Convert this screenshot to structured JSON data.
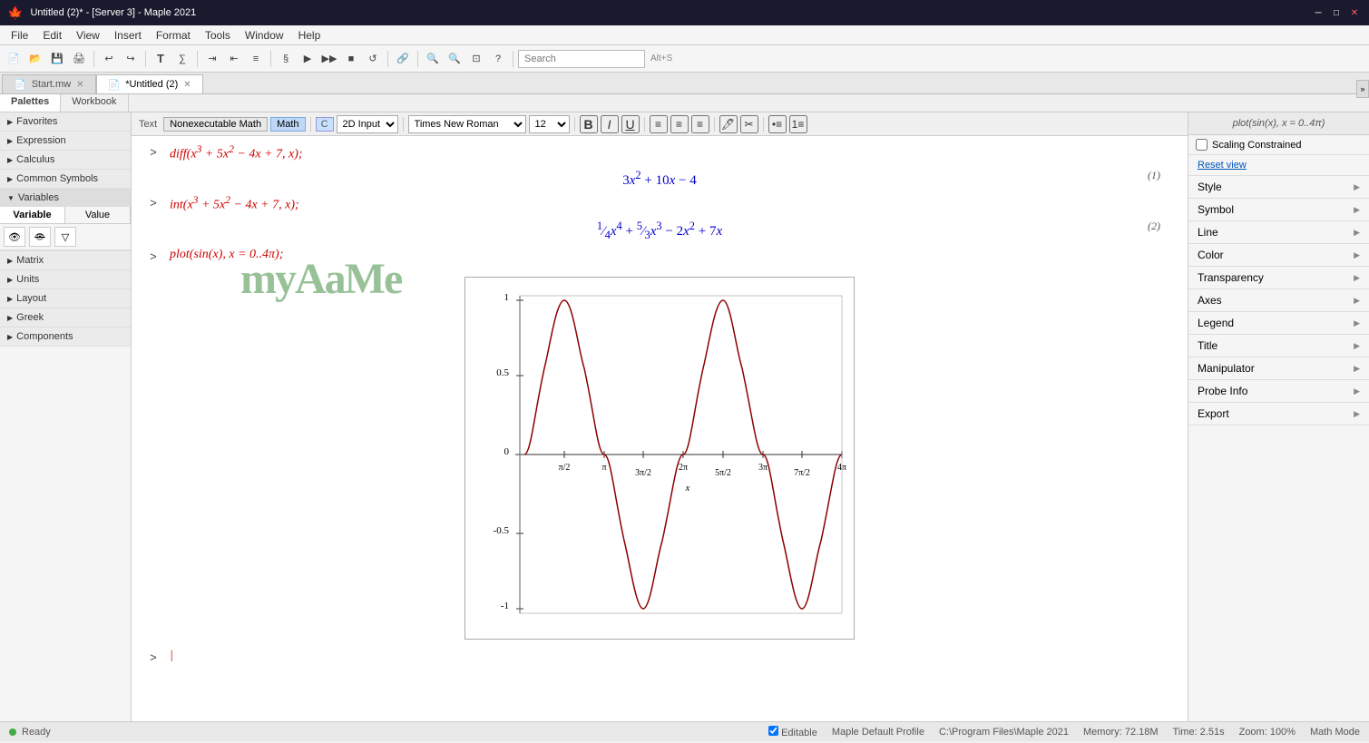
{
  "titlebar": {
    "title": "Untitled (2)* - [Server 3] - Maple 2021",
    "icon": "maple-icon",
    "controls": [
      "minimize",
      "maximize",
      "close"
    ]
  },
  "menubar": {
    "items": [
      "File",
      "Edit",
      "View",
      "Insert",
      "Format",
      "Tools",
      "Window",
      "Help"
    ]
  },
  "toolbar": {
    "search_placeholder": "Search",
    "search_shortcut": "Alt+S"
  },
  "tabs": [
    {
      "label": "Start.mw",
      "active": false
    },
    {
      "label": "*Untitled (2)",
      "active": true
    }
  ],
  "palettes_workbook": {
    "tabs": [
      "Palettes",
      "Workbook"
    ],
    "active": "Palettes"
  },
  "sidebar": {
    "sections": [
      {
        "label": "Favorites",
        "expanded": false
      },
      {
        "label": "Expression",
        "expanded": false
      },
      {
        "label": "Calculus",
        "expanded": false
      },
      {
        "label": "Common Symbols",
        "expanded": false
      },
      {
        "label": "Variables",
        "expanded": true
      }
    ],
    "variables": {
      "tabs": [
        "Variable",
        "Value"
      ],
      "active_tab": "Variable",
      "tools": [
        "eye-icon",
        "eye-slash-icon",
        "filter-icon"
      ]
    },
    "lower_sections": [
      {
        "label": "Matrix"
      },
      {
        "label": "Units"
      },
      {
        "label": "Layout"
      },
      {
        "label": "Greek"
      },
      {
        "label": "Components"
      }
    ]
  },
  "format_bar": {
    "style_label": "Text",
    "mode_buttons": [
      "Nonexecutable Math",
      "Math"
    ],
    "active_mode": "Math",
    "c_label": "C",
    "input_mode": "2D Input",
    "font_family": "Times New Roman",
    "font_size": "12",
    "bold": "B",
    "italic": "I",
    "underline": "U"
  },
  "worksheet": {
    "lines": [
      {
        "type": "input",
        "prompt": ">",
        "content": "diff(x³ + 5x² − 4x + 7, x);"
      },
      {
        "type": "output",
        "content": "3x² + 10x − 4",
        "number": "(1)"
      },
      {
        "type": "input",
        "prompt": ">",
        "content": "int(x³ + 5x² − 4x + 7, x);"
      },
      {
        "type": "output",
        "content": "¼x⁴ + 5/3x³ − 2x² + 7x",
        "number": "(2)"
      },
      {
        "type": "input",
        "prompt": ">",
        "content": "plot(sin(x), x = 0..4π);"
      }
    ],
    "plot": {
      "title": "plot(sin(x), x = 0..4π)",
      "x_min": 0,
      "x_max": "4π",
      "y_min": -1,
      "y_max": 1,
      "x_ticks": [
        "π/2",
        "π",
        "3π/2",
        "2π",
        "5π/2",
        "3π",
        "7π/2",
        "4π"
      ],
      "y_ticks": [
        "-1",
        "-0.5",
        "0",
        "0.5",
        "1"
      ],
      "curve_color": "#8b0000"
    }
  },
  "right_panel": {
    "plot_label": "plot(sin(x), x = 0..4π)",
    "reset_view": "Reset view",
    "scaling_constrained_label": "Scaling Constrained",
    "sections": [
      {
        "label": "Style"
      },
      {
        "label": "Symbol"
      },
      {
        "label": "Line"
      },
      {
        "label": "Color"
      },
      {
        "label": "Transparency"
      },
      {
        "label": "Axes"
      },
      {
        "label": "Legend"
      },
      {
        "label": "Title"
      },
      {
        "label": "Manipulator"
      },
      {
        "label": "Probe Info"
      },
      {
        "label": "Export"
      }
    ]
  },
  "statusbar": {
    "status": "Ready",
    "editable": "Editable",
    "profile": "Maple Default Profile",
    "path": "C:\\Program Files\\Maple 2021",
    "memory": "Memory: 72.18M",
    "time": "Time: 2.51s",
    "zoom": "Zoom: 100%",
    "mode": "Math Mode"
  }
}
